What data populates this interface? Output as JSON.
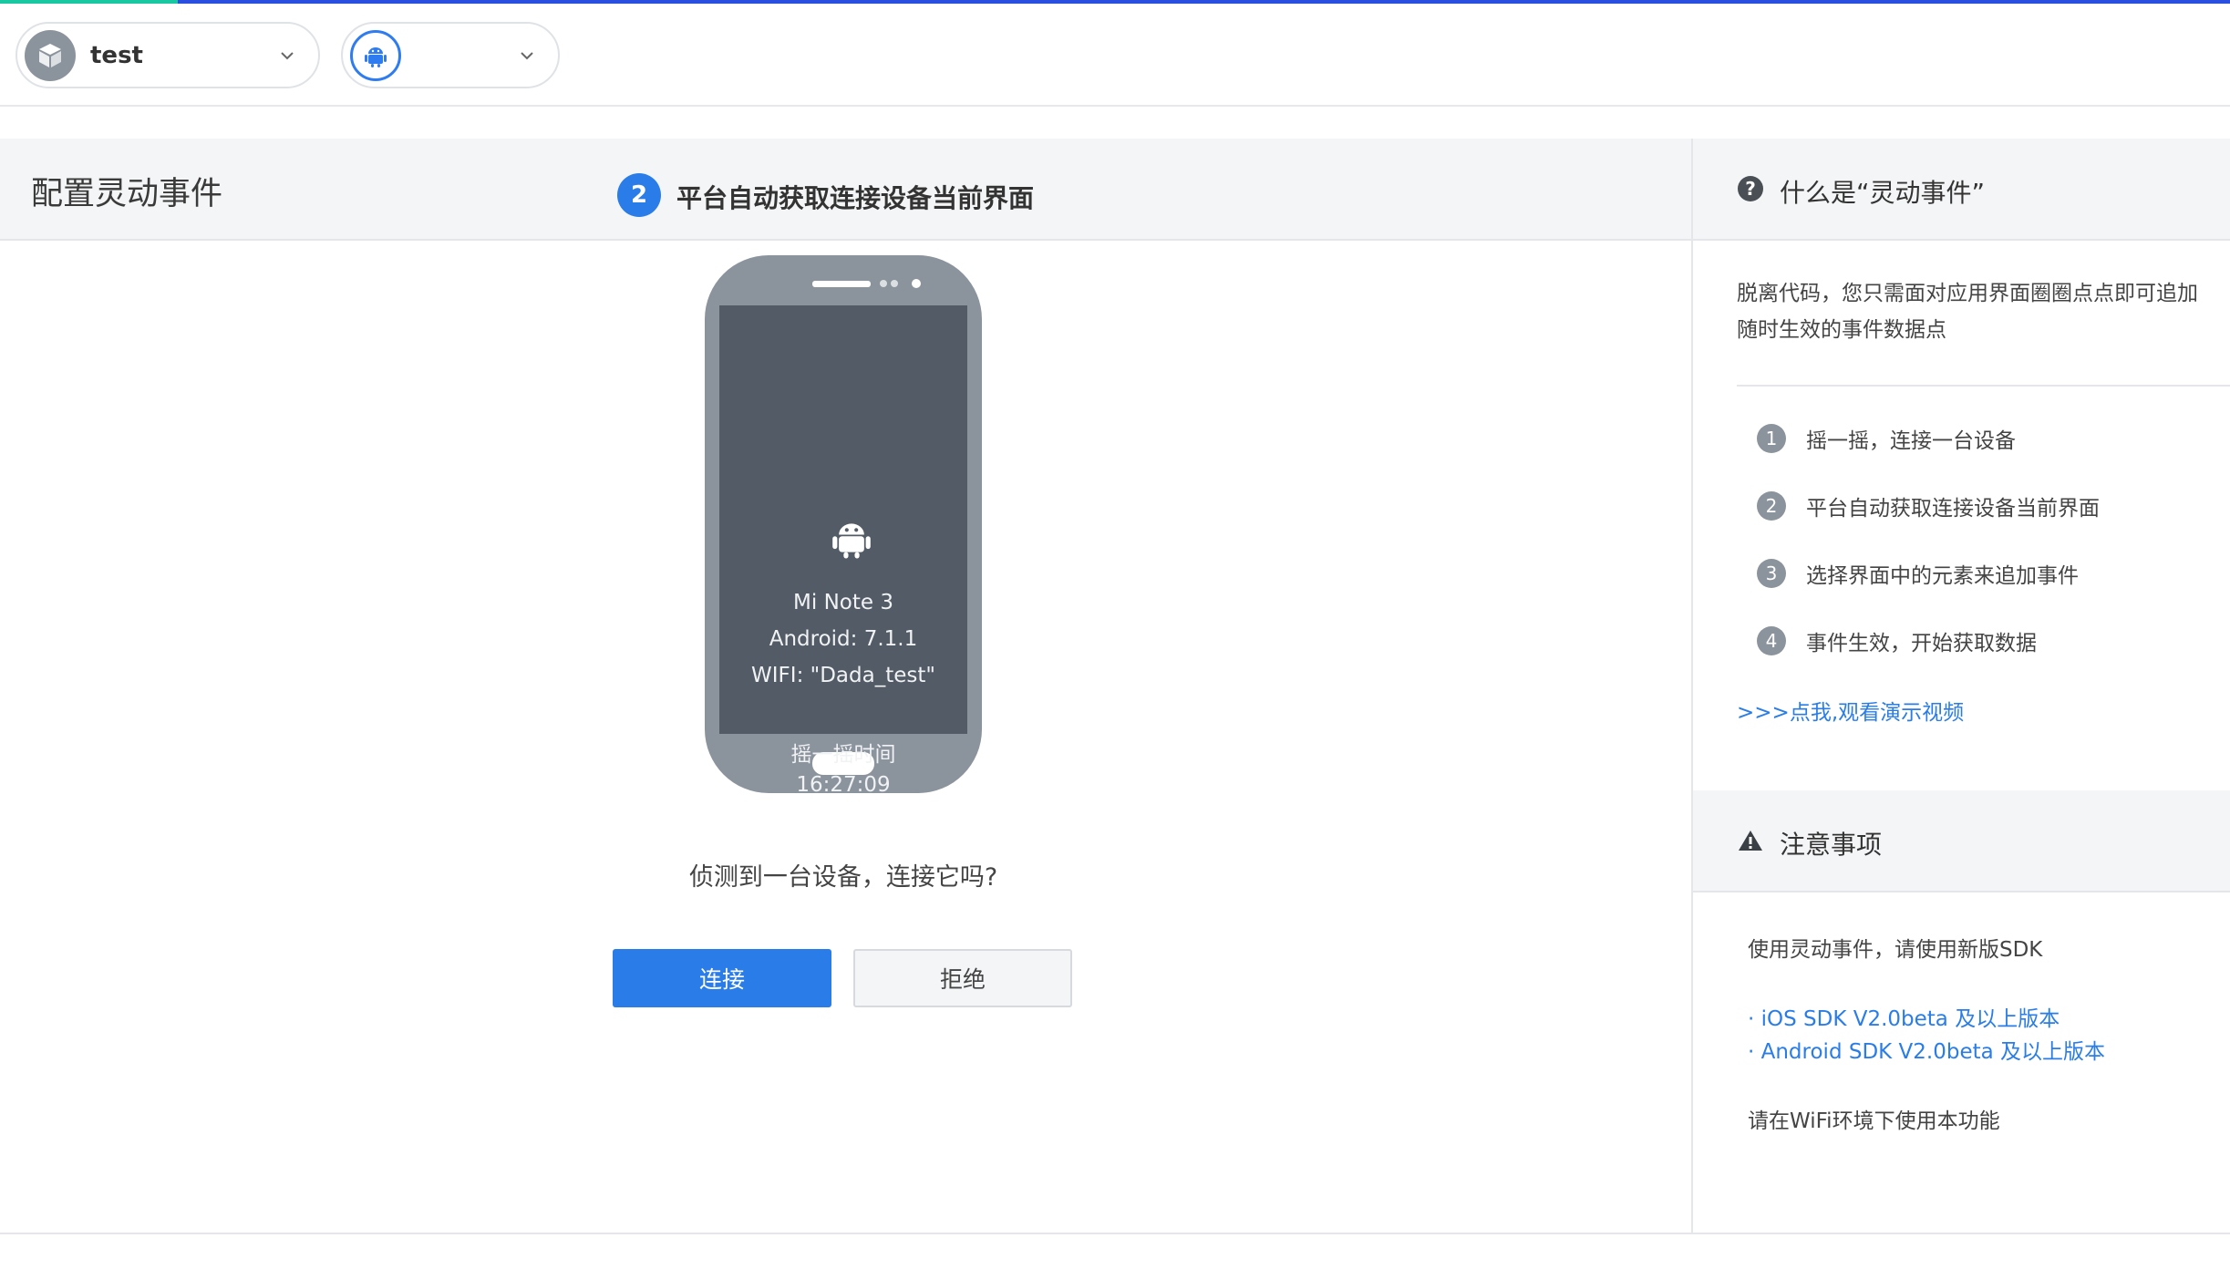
{
  "app_selector": {
    "name": "test",
    "icon": "box-icon"
  },
  "platform_selector": {
    "icon": "android-icon"
  },
  "main": {
    "title": "配置灵动事件",
    "current_step": {
      "number": "2",
      "label": "平台自动获取连接设备当前界面"
    },
    "device": {
      "model": "Mi Note 3",
      "android": "Android: 7.1.1",
      "wifi": "WIFI: \"Dada_test\"",
      "shake_label": "摇一摇时间",
      "shake_time": "16:27:09"
    },
    "prompt": "侦测到一台设备，连接它吗?",
    "connect_label": "连接",
    "reject_label": "拒绝"
  },
  "side": {
    "what_title": "什么是“灵动事件”",
    "description": "脱离代码，您只需面对应用界面圈圈点点即可追加随时生效的事件数据点",
    "steps": [
      {
        "num": "1",
        "label": "摇一摇，连接一台设备"
      },
      {
        "num": "2",
        "label": "平台自动获取连接设备当前界面"
      },
      {
        "num": "3",
        "label": "选择界面中的元素来追加事件"
      },
      {
        "num": "4",
        "label": "事件生效，开始获取数据"
      }
    ],
    "video_link": ">>>点我,观看演示视频",
    "notes_title": "注意事项",
    "note_sdk": "使用灵动事件，请使用新版SDK",
    "ios_sdk": "· iOS SDK V2.0beta 及以上版本",
    "android_sdk": "· Android SDK V2.0beta 及以上版本",
    "note_wifi": "请在WiFi环境下使用本功能"
  },
  "colors": {
    "accent": "#2a7de8",
    "phone_body": "#8b939d",
    "phone_screen": "#525b66",
    "progress_green": "#19c8a0",
    "progress_blue": "#2a4fe0"
  }
}
